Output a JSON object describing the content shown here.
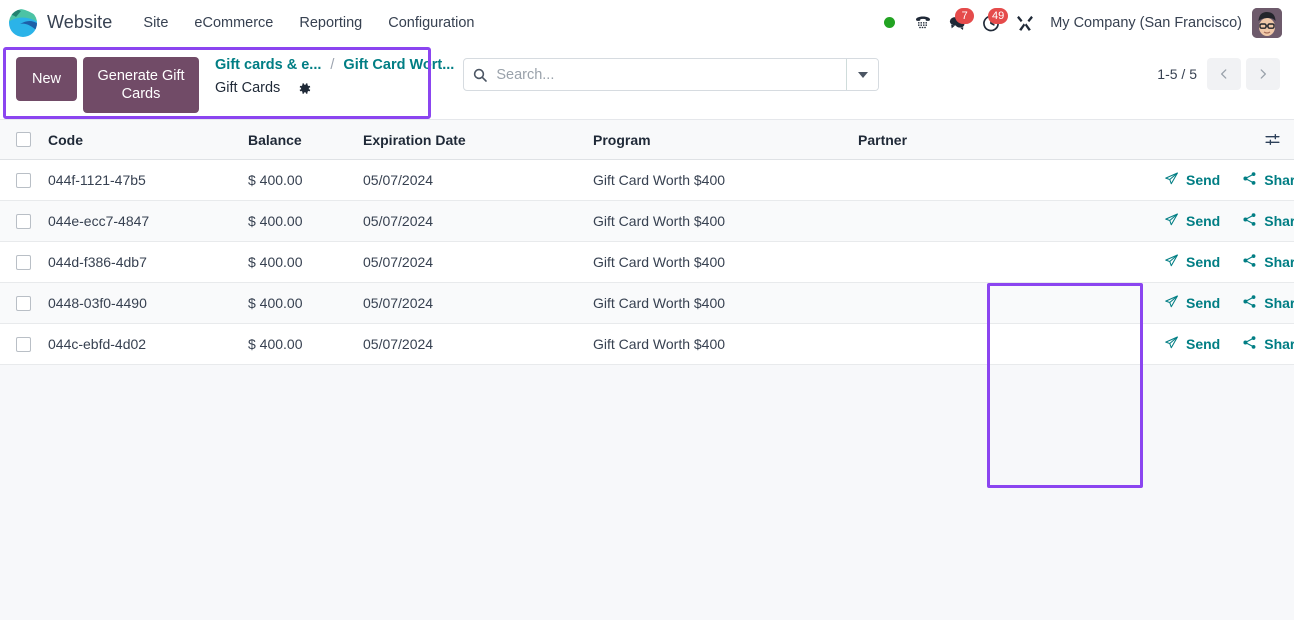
{
  "navbar": {
    "brand": "Website",
    "logo_icon": "odoo-logo-icon",
    "menu": [
      {
        "label": "Site"
      },
      {
        "label": "eCommerce"
      },
      {
        "label": "Reporting"
      },
      {
        "label": "Configuration"
      }
    ],
    "status_dot": {
      "icon": "presence-online-dot-icon",
      "color": "#22a322"
    },
    "voip_icon": "phone-icon",
    "messages": {
      "icon": "messages-icon",
      "badge": "7"
    },
    "activities": {
      "icon": "activities-clock-icon",
      "badge": "49"
    },
    "debug_icon": "developer-tools-icon",
    "company": "My Company (San Francisco)",
    "avatar_icon": "user-avatar"
  },
  "control_panel": {
    "new_label": "New",
    "generate_label": "Generate Gift Cards",
    "breadcrumb": {
      "items": [
        {
          "label": "Gift cards & e..."
        },
        {
          "label": "Gift Card Wort..."
        }
      ],
      "separator": "/",
      "current": "Gift Cards",
      "gear_icon": "gear-icon"
    },
    "search": {
      "placeholder": "Search...",
      "value": "",
      "icon": "search-icon",
      "toggle_icon": "chevron-down-icon"
    },
    "pager": {
      "count": "1-5 / 5",
      "prev_icon": "chevron-left-icon",
      "next_icon": "chevron-right-icon"
    },
    "highlight_color": "#8b45f0"
  },
  "table": {
    "columns": [
      {
        "key": "code",
        "label": "Code"
      },
      {
        "key": "balance",
        "label": "Balance"
      },
      {
        "key": "expiration",
        "label": "Expiration Date"
      },
      {
        "key": "program",
        "label": "Program"
      },
      {
        "key": "partner",
        "label": "Partner"
      }
    ],
    "optional_columns_icon": "column-settings-icon",
    "select_all_checkbox": "select-all-checkbox",
    "action_labels": {
      "send": "Send",
      "send_icon": "paper-plane-icon",
      "share": "Share",
      "share_icon": "share-nodes-icon"
    },
    "accent_color": "#017e84",
    "rows": [
      {
        "code": "044f-1121-47b5",
        "balance": "$ 400.00",
        "expiration": "05/07/2024",
        "program": "Gift Card Worth $400",
        "partner": ""
      },
      {
        "code": "044e-ecc7-4847",
        "balance": "$ 400.00",
        "expiration": "05/07/2024",
        "program": "Gift Card Worth $400",
        "partner": ""
      },
      {
        "code": "044d-f386-4db7",
        "balance": "$ 400.00",
        "expiration": "05/07/2024",
        "program": "Gift Card Worth $400",
        "partner": ""
      },
      {
        "code": "0448-03f0-4490",
        "balance": "$ 400.00",
        "expiration": "05/07/2024",
        "program": "Gift Card Worth $400",
        "partner": ""
      },
      {
        "code": "044c-ebfd-4d02",
        "balance": "$ 400.00",
        "expiration": "05/07/2024",
        "program": "Gift Card Worth $400",
        "partner": ""
      }
    ]
  }
}
